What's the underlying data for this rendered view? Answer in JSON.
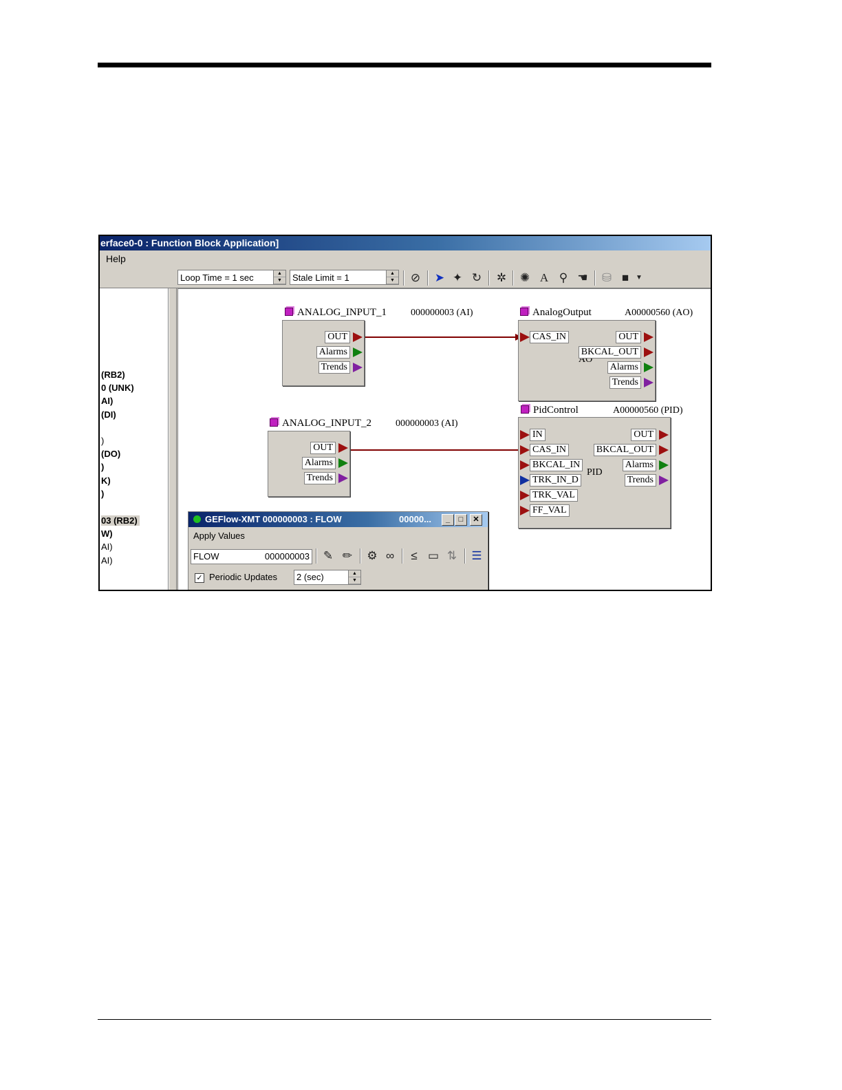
{
  "window": {
    "title": "erface0-0 : Function Block Application]"
  },
  "menu": {
    "help": "Help"
  },
  "toolbar": {
    "loop_time": "Loop Time = 1 sec",
    "stale_limit": "Stale Limit = 1",
    "icons": [
      "check-icon",
      "pointer-icon",
      "link-icon",
      "refresh-icon",
      "sparkle-icon",
      "gear-icon",
      "text-icon",
      "zoom-icon",
      "hand-icon",
      "paint-icon",
      "color-icon",
      "dropdown-icon"
    ]
  },
  "tree": {
    "items": [
      {
        "label": "(RB2)"
      },
      {
        "label": "0 (UNK)"
      },
      {
        "label": "AI)"
      },
      {
        "label": "(DI)"
      },
      {
        "label": ")"
      },
      {
        "label": "(DO)"
      },
      {
        "label": ")"
      },
      {
        "label": "K)"
      },
      {
        "label": ")"
      },
      {
        "label": "03 (RB2)"
      },
      {
        "label": "W)"
      },
      {
        "label": "AI)"
      },
      {
        "label": "AI)"
      }
    ]
  },
  "blocks": {
    "ai1": {
      "title": "ANALOG_INPUT_1",
      "id": "000000003 (AI)",
      "ports": {
        "out": "OUT",
        "alarms": "Alarms",
        "trends": "Trends"
      }
    },
    "ai2": {
      "title": "ANALOG_INPUT_2",
      "id": "000000003 (AI)",
      "ports": {
        "out": "OUT",
        "alarms": "Alarms",
        "trends": "Trends"
      }
    },
    "ao": {
      "title": "AnalogOutput",
      "id": "A00000560 (AO)",
      "type": "AO",
      "ports": {
        "cas_in": "CAS_IN",
        "out": "OUT",
        "bkcal_out": "BKCAL_OUT",
        "alarms": "Alarms",
        "trends": "Trends"
      }
    },
    "pid": {
      "title": "PidControl",
      "id": "A00000560 (PID)",
      "type": "PID",
      "inputs": {
        "in": "IN",
        "cas_in": "CAS_IN",
        "bkcal_in": "BKCAL_IN",
        "trk_in_d": "TRK_IN_D",
        "trk_val": "TRK_VAL",
        "ff_val": "FF_VAL"
      },
      "outputs": {
        "out": "OUT",
        "bkcal_out": "BKCAL_OUT",
        "alarms": "Alarms",
        "trends": "Trends"
      }
    }
  },
  "dialog": {
    "title": "GEFlow-XMT  000000003 : FLOW",
    "title_right": "00000...",
    "menu": "Apply Values",
    "field_name": "FLOW",
    "field_id": "000000003",
    "periodic_label": "Periodic Updates",
    "periodic_checked": true,
    "period_value": "2 (sec)"
  },
  "colors": {
    "link": "#800000",
    "title_bar": "#0a246a",
    "port_red": "#9c1010",
    "port_green": "#108010",
    "port_purple": "#8020a0",
    "port_blue": "#1030a0"
  }
}
